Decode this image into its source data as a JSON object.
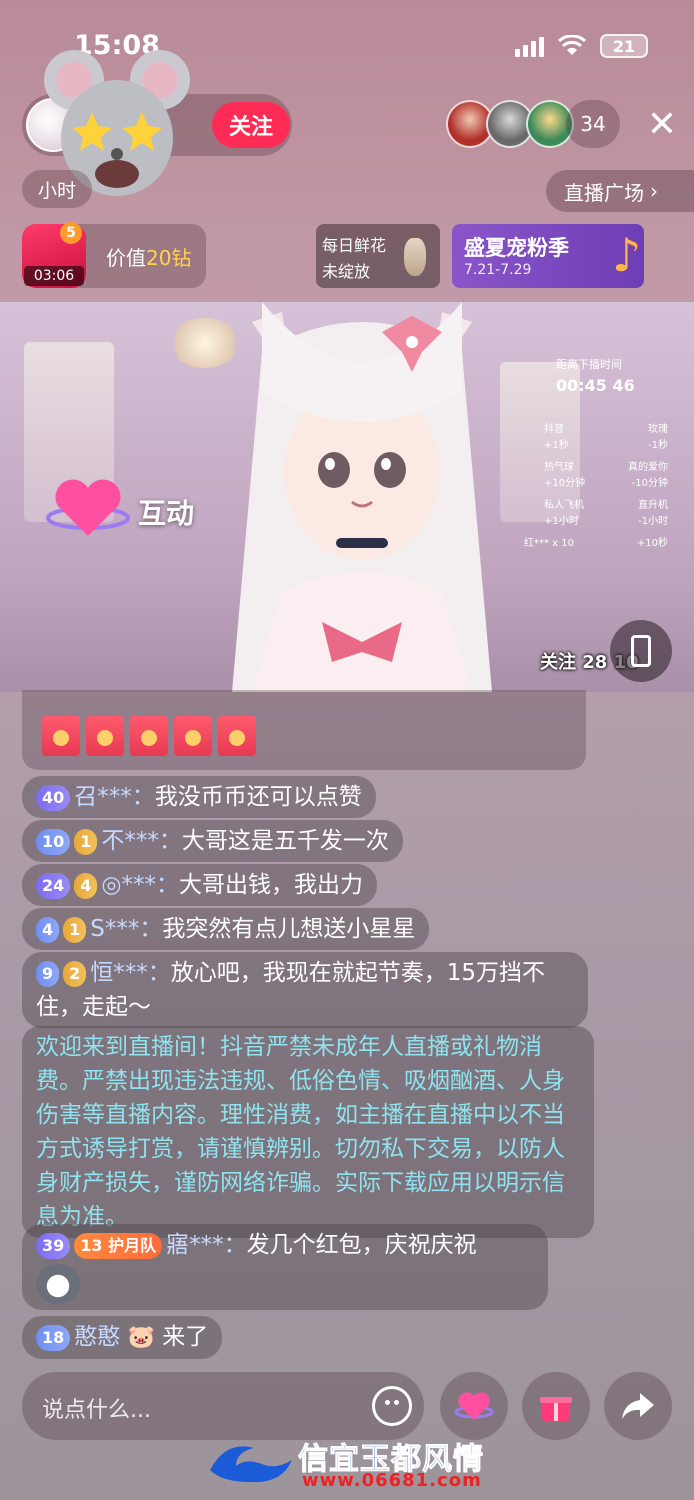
{
  "status": {
    "time": "15:08",
    "battery": "21"
  },
  "anchor": {
    "follow_label": "关注",
    "sub_label": "小时"
  },
  "viewers": {
    "count": "34"
  },
  "plaza": {
    "label": "直播广场"
  },
  "gift": {
    "badge": "5",
    "timer": "03:06",
    "value_prefix": "价值",
    "value_num": "20钻"
  },
  "flower": {
    "line1": "每日鲜花",
    "line2": "未绽放"
  },
  "season": {
    "title": "盛夏宠粉季",
    "date": "7.21-7.29"
  },
  "video": {
    "interact_label": "互动",
    "scoreboard": {
      "title": "距离下播时间",
      "time": "00:45 46",
      "rows": [
        {
          "left": "抖音",
          "right": "玫瑰"
        },
        {
          "left": "+1秒",
          "right": "-1秒"
        },
        {
          "left": "热气球",
          "right": "真的爱你"
        },
        {
          "left": "+10分钟",
          "right": "-10分钟"
        },
        {
          "left": "私人飞机",
          "right": "直升机"
        },
        {
          "left": "+1小时",
          "right": "-1小时"
        },
        {
          "left": "红*** x 10",
          "right": "+10秒"
        }
      ]
    },
    "follow_overlay": "关注 28 10"
  },
  "chat": [
    {
      "level": "40",
      "fan_level": "",
      "user": "召***：",
      "message": "我没币币还可以点赞"
    },
    {
      "level": "10",
      "fan_level": "1",
      "user": "不***：",
      "message": "大哥这是五千发一次"
    },
    {
      "level": "24",
      "fan_level": "4",
      "user": "◎***：",
      "message": "大哥出钱，我出力"
    },
    {
      "level": "4",
      "fan_level": "1",
      "user": "S***：",
      "message": "我突然有点儿想送小星星"
    },
    {
      "level": "9",
      "fan_level": "2",
      "user": "恒***：",
      "message": "放心吧，我现在就起节奏，15万挡不住，走起～"
    }
  ],
  "system_message": "欢迎来到直播间！抖音严禁未成年人直播或礼物消费。严禁出现违法违规、低俗色情、吸烟酗酒、人身伤害等直播内容。理性消费，如主播在直播中以不当方式诱导打赏，请谨慎辨别。切勿私下交易，以防人身财产损失，谨防网络诈骗。实际下载应用以明示信息为准。",
  "chat2": {
    "level": "39",
    "fan_level": "13",
    "fan_club": "护月队",
    "user": "寤***：",
    "message": "发几个红包，庆祝庆祝"
  },
  "join": {
    "level": "18",
    "user": "憨憨",
    "message": "来了"
  },
  "input": {
    "placeholder": "说点什么..."
  },
  "watermark": {
    "text": "信宜玉都风情",
    "url": "www.06681.com"
  },
  "colors": {
    "follow": "#fe2c55",
    "season": "#7a48bf",
    "system_text": "#8fe3ee"
  }
}
